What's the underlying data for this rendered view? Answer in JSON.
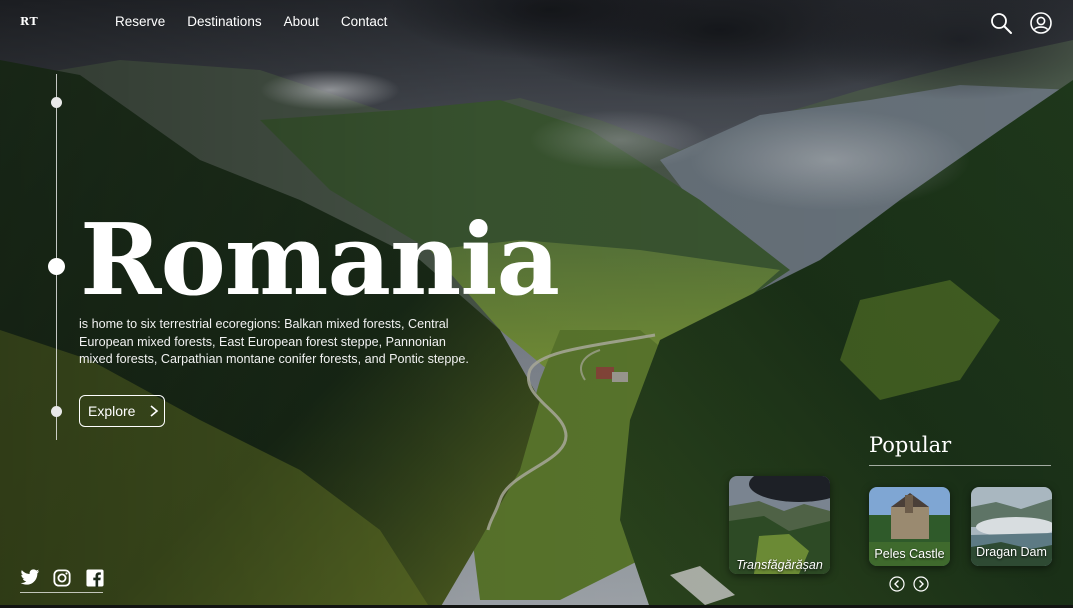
{
  "header": {
    "logo": "RT",
    "nav": [
      "Reserve",
      "Destinations",
      "About",
      "Contact"
    ],
    "icons": [
      "search-icon",
      "user-icon"
    ]
  },
  "hero": {
    "title": "Romania",
    "description": "is home to six terrestrial ecoregions: Balkan mixed forests, Central European mixed forests, East European forest steppe, Pannonian mixed forests, Carpathian montane conifer forests, and Pontic steppe.",
    "cta_label": "Explore",
    "cta_icon": "chevron-right-icon"
  },
  "timeline": {
    "dots": 3,
    "active_index": 1
  },
  "social": {
    "icons": [
      "twitter-icon",
      "instagram-icon",
      "facebook-icon"
    ]
  },
  "popular": {
    "title": "Popular",
    "cards": [
      {
        "label": "Transfăgărășan"
      },
      {
        "label": "Peles Castle"
      },
      {
        "label": "Dragan Dam"
      }
    ],
    "prev_icon": "chevron-left-circle-icon",
    "next_icon": "chevron-right-circle-icon"
  },
  "colors": {
    "text": "#ffffff",
    "forest": "#1f3a1e",
    "sky": "#6d7580"
  }
}
